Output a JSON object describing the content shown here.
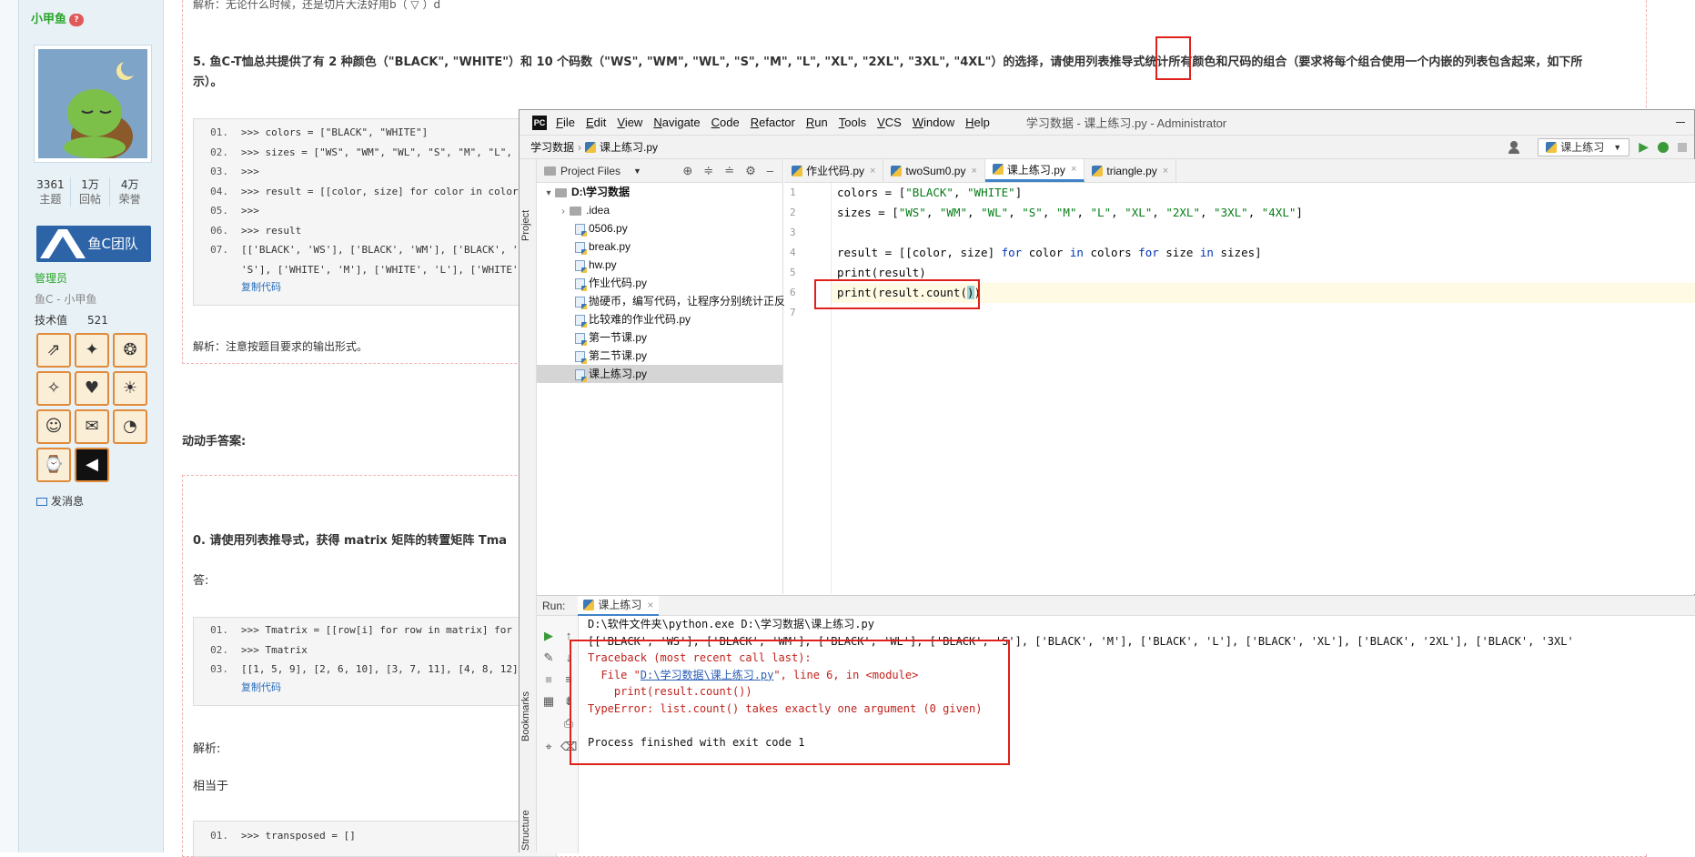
{
  "forum": {
    "author": {
      "name": "小甲鱼",
      "badge": "?"
    },
    "stats": [
      {
        "value": "3361",
        "label": "主题"
      },
      {
        "value": "1万",
        "label": "回帖"
      },
      {
        "value": "4万",
        "label": "荣誉"
      }
    ],
    "team_banner": "鱼C团队",
    "role": "管理员",
    "group": "鱼C - 小甲鱼",
    "tech": {
      "label": "技术值",
      "value": "521"
    },
    "send_message": "发消息",
    "top_fragment": "解析：无论什么时候，还是切片大法好用b（ ▽ ）d",
    "question5": "5. 鱼C-T恤总共提供了有 2 种颜色（\"BLACK\", \"WHITE\"）和 10 个码数（\"WS\", \"WM\", \"WL\", \"S\", \"M\", \"L\", \"XL\", \"2XL\", \"3XL\", \"4XL\"）的选择，请使用列表推导式统计所有颜色和尺码的组合（要求将每个组合使用一个内嵌的列表包含起来，如下所",
    "question5_cont": "示）。",
    "code5": [
      {
        "n": "01.",
        "t": ">>> colors = [\"BLACK\", \"WHITE\"]"
      },
      {
        "n": "02.",
        "t": ">>> sizes = [\"WS\", \"WM\", \"WL\", \"S\", \"M\", \"L\","
      },
      {
        "n": "03.",
        "t": ">>>"
      },
      {
        "n": "04.",
        "t": ">>> result = [[color, size] for color in colors"
      },
      {
        "n": "05.",
        "t": ">>>"
      },
      {
        "n": "06.",
        "t": ">>> result"
      },
      {
        "n": "07.",
        "t": "[['BLACK', 'WS'], ['BLACK', 'WM'], ['BLACK', '"
      },
      {
        "n": "",
        "t": "'S'], ['WHITE', 'M'], ['WHITE', 'L'], ['WHITE'"
      }
    ],
    "copy_code": "复制代码",
    "analysis5": "解析：注意按题目要求的输出形式。",
    "answer_heading": "动动手答案:",
    "question0": "0. 请使用列表推导式，获得 matrix 矩阵的转置矩阵 Tma",
    "answer_label": "答:",
    "code0": [
      {
        "n": "01.",
        "t": ">>> Tmatrix = [[row[i] for row in matrix] for"
      },
      {
        "n": "02.",
        "t": ">>> Tmatrix"
      },
      {
        "n": "03.",
        "t": "[[1, 5, 9], [2, 6, 10], [3, 7, 11], [4, 8, 12]"
      }
    ],
    "analysis_label": "解析:",
    "equivalent": "相当于",
    "code1_line": {
      "n": "01.",
      "t": ">>> transposed = []"
    }
  },
  "ide": {
    "app_icon": "PC",
    "menu": [
      "File",
      "Edit",
      "View",
      "Navigate",
      "Code",
      "Refactor",
      "Run",
      "Tools",
      "VCS",
      "Window",
      "Help"
    ],
    "title": "学习数据 - 课上练习.py - Administrator",
    "breadcrumb": [
      "学习数据",
      "课上练习.py"
    ],
    "run_config": "课上练习",
    "project_header": "Project Files",
    "tree": [
      {
        "label": "D:\\学习数据",
        "type": "root"
      },
      {
        "label": ".idea",
        "type": "folder"
      },
      {
        "label": "0506.py",
        "type": "file"
      },
      {
        "label": "break.py",
        "type": "file"
      },
      {
        "label": "hw.py",
        "type": "file"
      },
      {
        "label": "作业代码.py",
        "type": "file"
      },
      {
        "label": "抛硬币，编写代码，让程序分别统计正反",
        "type": "file"
      },
      {
        "label": "比较难的作业代码.py",
        "type": "file"
      },
      {
        "label": "第一节课.py",
        "type": "file"
      },
      {
        "label": "第二节课.py",
        "type": "file"
      },
      {
        "label": "课上练习.py",
        "type": "file",
        "selected": true
      }
    ],
    "tabs": [
      {
        "label": "作业代码.py",
        "active": false
      },
      {
        "label": "twoSum0.py",
        "active": false
      },
      {
        "label": "课上练习.py",
        "active": true
      },
      {
        "label": "triangle.py",
        "active": false
      }
    ],
    "line_numbers": [
      "1",
      "2",
      "3",
      "4",
      "5",
      "6",
      "7"
    ],
    "run_label": "Run:",
    "run_tab": "课上练习",
    "console": {
      "cmd": "D:\\软件文件夹\\python.exe D:\\学习数据\\课上练习.py",
      "output": "[['BLACK', 'WS'], ['BLACK', 'WM'], ['BLACK', 'WL'], ['BLACK', 'S'], ['BLACK', 'M'], ['BLACK', 'L'], ['BLACK', 'XL'], ['BLACK', '2XL'], ['BLACK', '3XL'",
      "traceback": "Traceback (most recent call last):",
      "file_prefix": "  File \"",
      "file_link": "D:\\学习数据\\课上练习.py",
      "file_suffix": "\", line 6, in <module>",
      "code_line": "    print(result.count())",
      "error": "TypeError: list.count() takes exactly one argument (0 given)",
      "exit": "Process finished with exit code 1"
    },
    "side_labels": {
      "project": "Project",
      "bookmarks": "Bookmarks",
      "structure": "Structure"
    }
  },
  "colors": {
    "highlight_box": "#e0201a",
    "keyword": "#0033b3",
    "string": "#067d17"
  }
}
